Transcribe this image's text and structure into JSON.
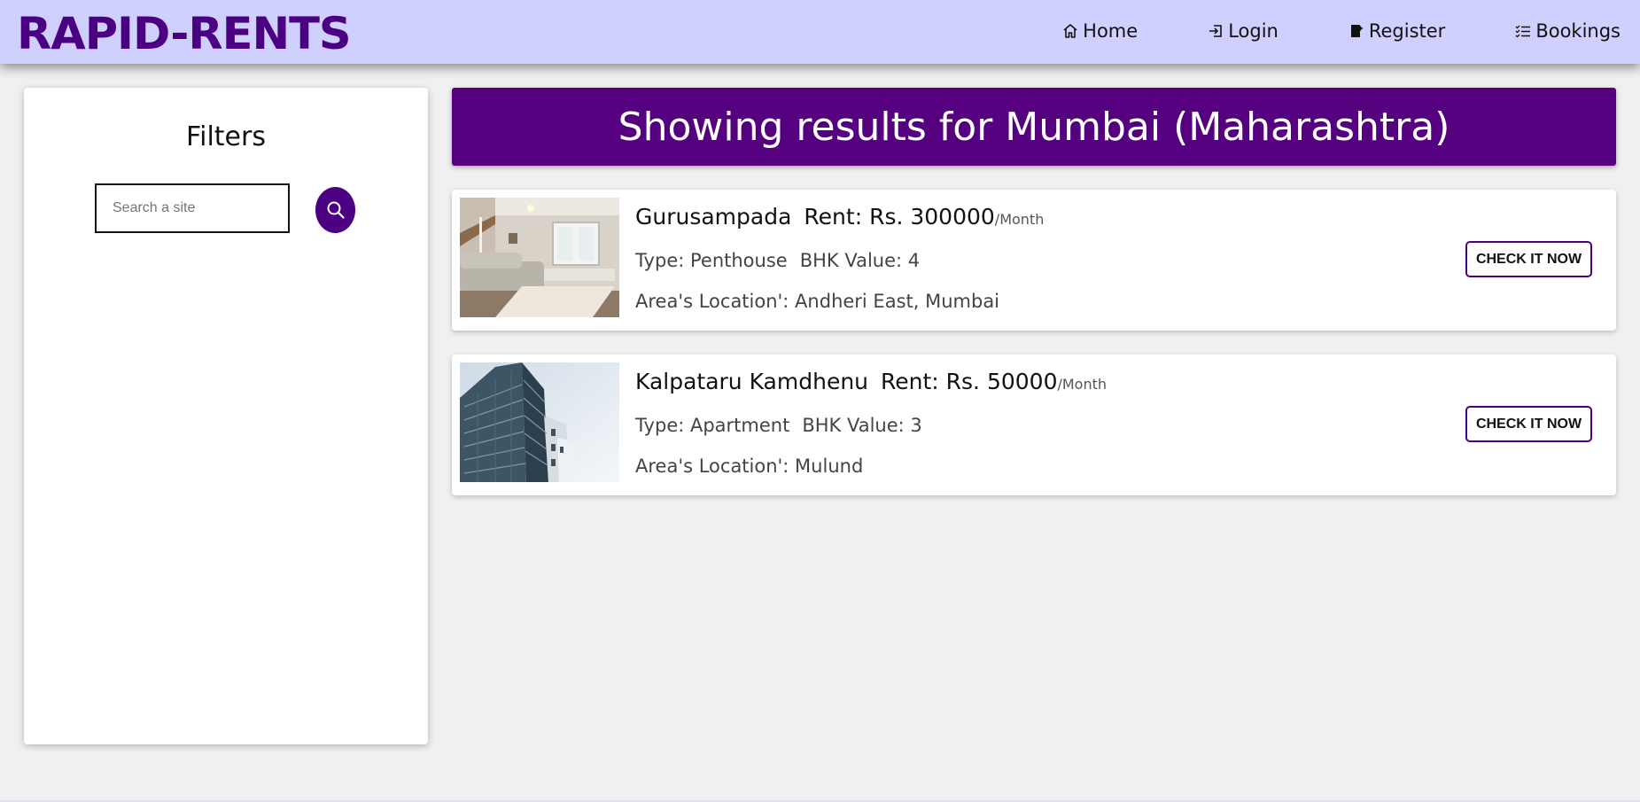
{
  "brand": "RAPID-RENTS",
  "nav": {
    "items": [
      {
        "label": "Home",
        "icon": "home-icon"
      },
      {
        "label": "Login",
        "icon": "login-icon"
      },
      {
        "label": "Register",
        "icon": "register-icon"
      },
      {
        "label": "Bookings",
        "icon": "list-icon"
      }
    ]
  },
  "filters": {
    "title": "Filters",
    "search_placeholder": "Search a site",
    "search_value": ""
  },
  "results": {
    "heading": "Showing results for Mumbai (Maharashtra)",
    "listings": [
      {
        "name": "Gurusampada",
        "rent": "Rent: Rs. 300000",
        "per": "/Month",
        "type": "Type: Penthouse",
        "bhk": "BHK Value: 4",
        "location": "Area's Location': Andheri East, Mumbai",
        "button": "CHECK IT NOW",
        "image": "living-room-photo"
      },
      {
        "name": "Kalpataru Kamdhenu",
        "rent": "Rent: Rs. 50000",
        "per": "/Month",
        "type": "Type: Apartment",
        "bhk": "BHK Value: 3",
        "location": "Area's Location': Mulund",
        "button": "CHECK IT NOW",
        "image": "building-photo"
      }
    ]
  },
  "colors": {
    "navbar_bg": "#d0d0fe",
    "brand": "#4b0082",
    "header_bg": "#54007f",
    "page_bg": "#f0f0f0"
  }
}
